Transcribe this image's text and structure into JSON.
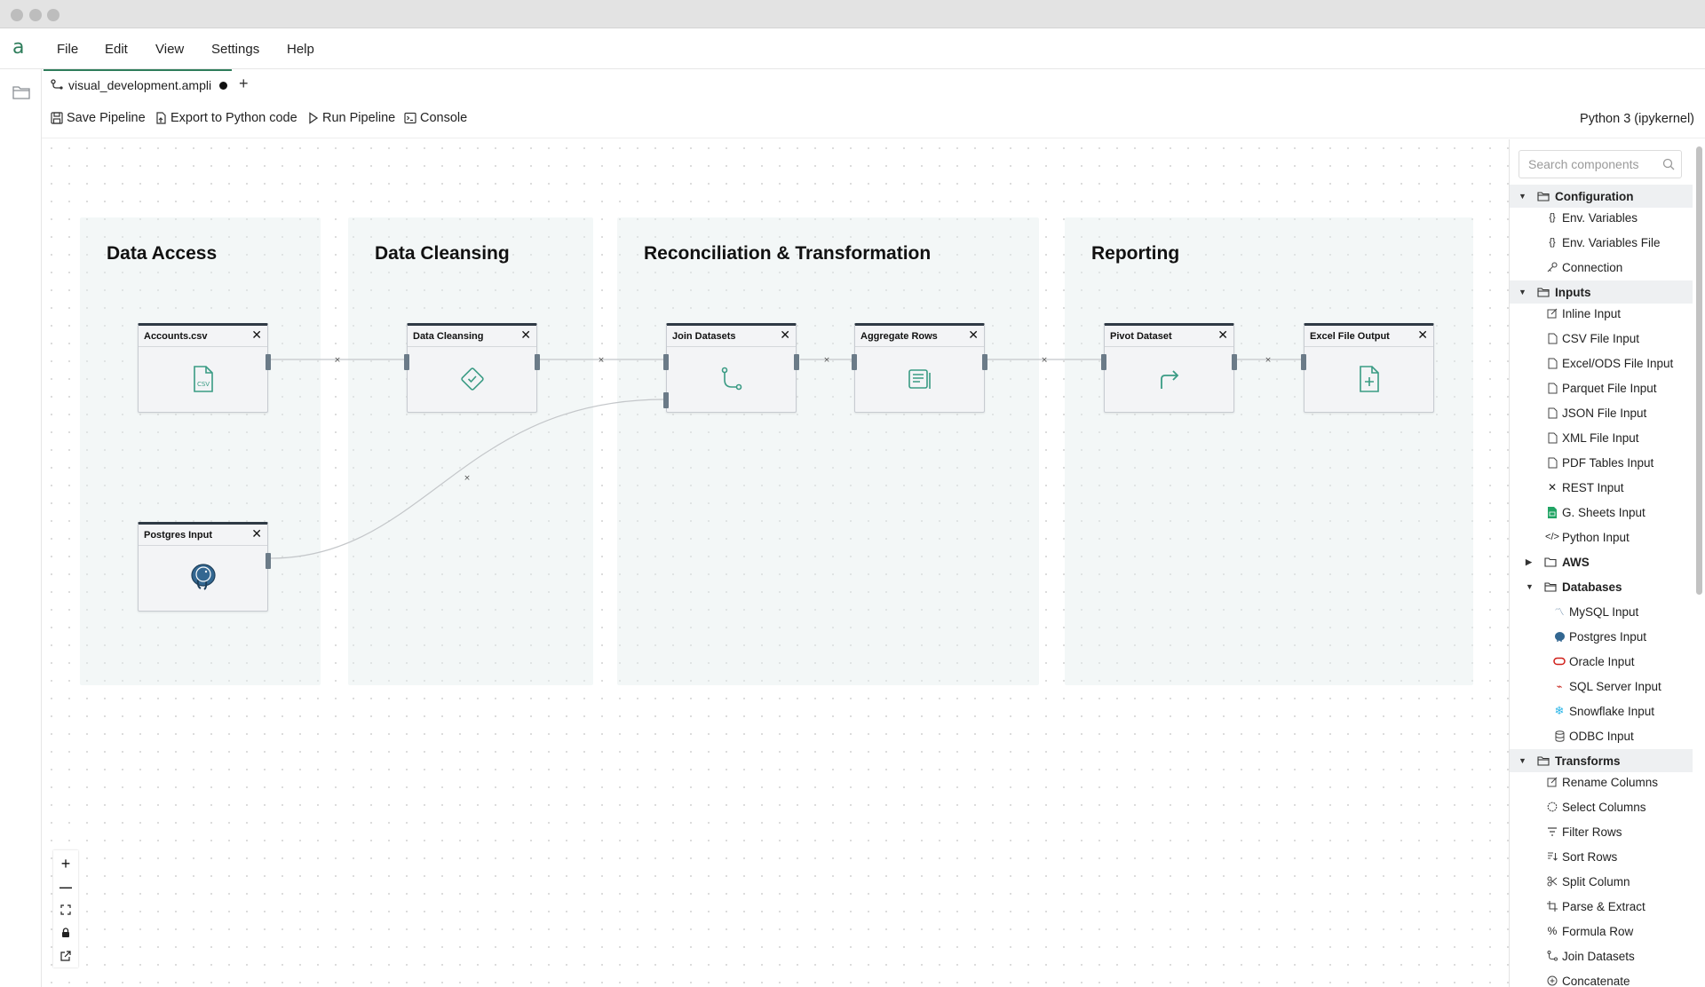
{
  "menu": {
    "file": "File",
    "edit": "Edit",
    "view": "View",
    "settings": "Settings",
    "help": "Help"
  },
  "tab": {
    "label": "visual_development.ampli",
    "add": "+"
  },
  "toolbar": {
    "save": "Save Pipeline",
    "export": "Export to Python code",
    "run": "Run Pipeline",
    "console": "Console",
    "kernel": "Python 3 (ipykernel)"
  },
  "groups": [
    {
      "title": "Data Access"
    },
    {
      "title": "Data Cleansing"
    },
    {
      "title": "Reconciliation & Transformation"
    },
    {
      "title": "Reporting"
    }
  ],
  "nodes": {
    "accounts": "Accounts.csv",
    "postgres": "Postgres Input",
    "cleansing": "Data Cleansing",
    "join": "Join Datasets",
    "aggregate": "Aggregate Rows",
    "pivot": "Pivot Dataset",
    "excel": "Excel File Output",
    "close": "✕"
  },
  "canvas_controls": {
    "zoom_in": "+",
    "zoom_out": "—"
  },
  "sidebar": {
    "search_placeholder": "Search components",
    "configuration": {
      "label": "Configuration",
      "items": [
        "Env. Variables",
        "Env. Variables File",
        "Connection"
      ]
    },
    "inputs": {
      "label": "Inputs",
      "items": [
        "Inline Input",
        "CSV File Input",
        "Excel/ODS File Input",
        "Parquet File Input",
        "JSON File Input",
        "XML File Input",
        "PDF Tables Input",
        "REST Input",
        "G. Sheets Input",
        "Python Input"
      ]
    },
    "aws": {
      "label": "AWS"
    },
    "databases": {
      "label": "Databases",
      "items": [
        "MySQL Input",
        "Postgres Input",
        "Oracle Input",
        "SQL Server Input",
        "Snowflake Input",
        "ODBC Input"
      ]
    },
    "transforms": {
      "label": "Transforms",
      "items": [
        "Rename Columns",
        "Select Columns",
        "Filter Rows",
        "Sort Rows",
        "Split Column",
        "Parse & Extract",
        "Formula Row",
        "Join Datasets",
        "Concatenate"
      ]
    }
  }
}
